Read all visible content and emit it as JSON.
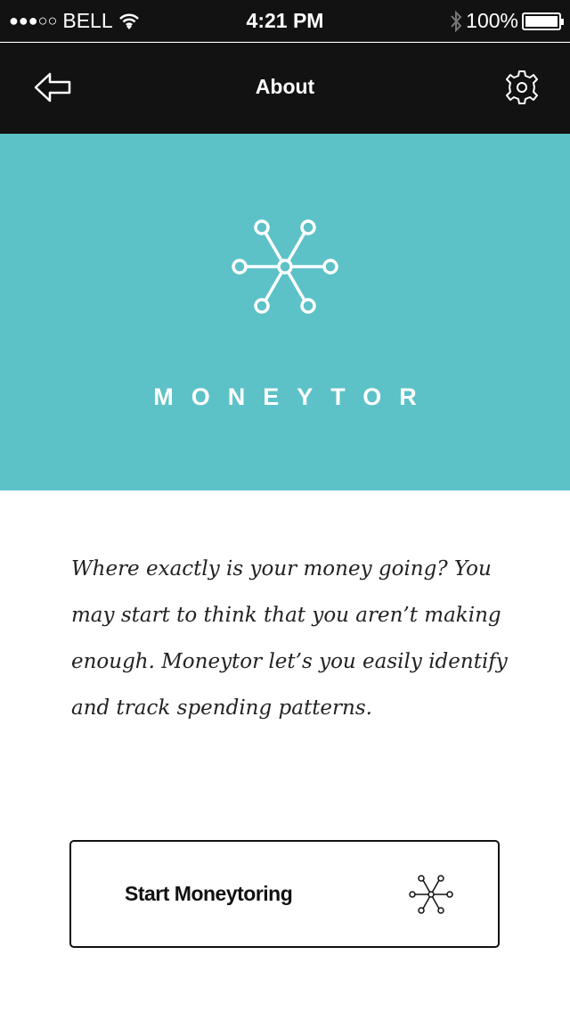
{
  "status_bar": {
    "signal": "●●●○○",
    "carrier": "BELL",
    "time": "4:21 PM",
    "battery": "100%",
    "battery_level": 1.0
  },
  "nav": {
    "title": "About",
    "back_icon": "back-arrow-icon",
    "settings_icon": "gear-icon"
  },
  "hero": {
    "brand": "MONEYTOR",
    "background": "#5cc2c8",
    "logo_icon": "network-node-icon"
  },
  "description": "Where exactly is your money going? You may start to think that you aren’t making enough. Moneytor let’s you easily identify and track spending patterns.",
  "cta": {
    "label": "Start Moneytoring",
    "icon": "network-node-icon"
  }
}
